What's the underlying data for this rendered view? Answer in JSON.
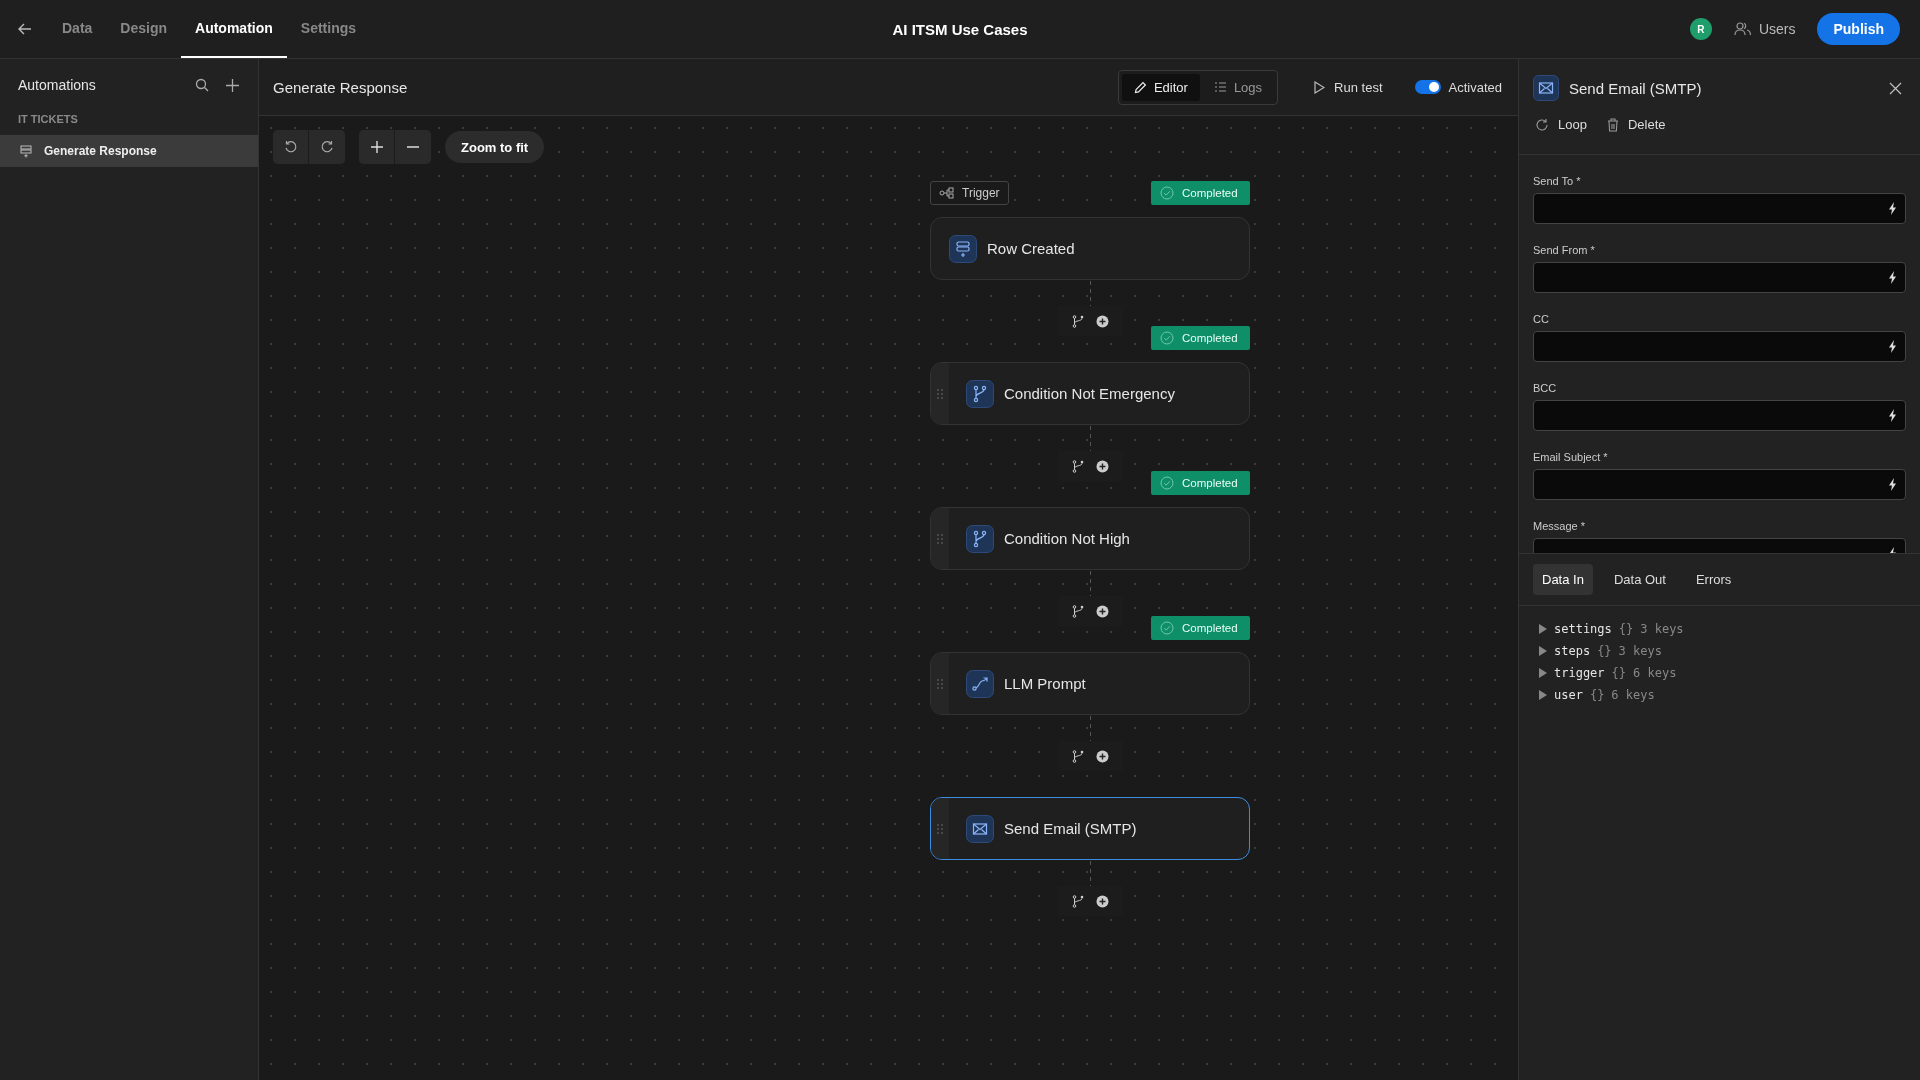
{
  "nav": {
    "tabs": [
      {
        "label": "Data",
        "selected": false
      },
      {
        "label": "Design",
        "selected": false
      },
      {
        "label": "Automation",
        "selected": true
      },
      {
        "label": "Settings",
        "selected": false
      }
    ],
    "app_title": "AI ITSM Use Cases",
    "avatar": "R",
    "users": "Users",
    "publish": "Publish"
  },
  "sidebar": {
    "title": "Automations",
    "group": "IT TICKETS",
    "items": [
      {
        "label": "Generate Response",
        "selected": true
      }
    ]
  },
  "editor": {
    "title": "Generate Response",
    "modes": [
      {
        "label": "Editor",
        "selected": true
      },
      {
        "label": "Logs",
        "selected": false
      }
    ],
    "run": "Run test",
    "activated": {
      "label": "Activated",
      "on": true
    }
  },
  "toolbar": {
    "zoom_fit": "Zoom to fit"
  },
  "flow": {
    "trigger_label": "Trigger",
    "steps": [
      {
        "kind": "trigger",
        "title": "Row Created",
        "status": "Completed",
        "selected": false
      },
      {
        "kind": "condition",
        "title": "Condition Not Emergency",
        "status": "Completed",
        "selected": false
      },
      {
        "kind": "condition",
        "title": "Condition Not High",
        "status": "Completed",
        "selected": false
      },
      {
        "kind": "llm",
        "title": "LLM Prompt",
        "status": "Completed",
        "selected": false
      },
      {
        "kind": "email",
        "title": "Send Email (SMTP)",
        "selected": true
      }
    ]
  },
  "panel": {
    "title": "Send Email (SMTP)",
    "actions": [
      {
        "kind": "loop",
        "label": "Loop"
      },
      {
        "kind": "delete",
        "label": "Delete"
      }
    ],
    "fields": [
      {
        "label": "Send To *"
      },
      {
        "label": "Send From *"
      },
      {
        "label": "CC"
      },
      {
        "label": "BCC"
      },
      {
        "label": "Email Subject *"
      },
      {
        "label": "Message *"
      }
    ],
    "data_tabs": [
      {
        "label": "Data In",
        "selected": true
      },
      {
        "label": "Data Out",
        "selected": false
      },
      {
        "label": "Errors",
        "selected": false
      }
    ],
    "tree": [
      {
        "key": "settings",
        "type": "{}",
        "count": "3 keys"
      },
      {
        "key": "steps",
        "type": "{}",
        "count": "3 keys"
      },
      {
        "key": "trigger",
        "type": "{}",
        "count": "6 keys"
      },
      {
        "key": "user",
        "type": "{}",
        "count": "6 keys"
      }
    ]
  }
}
